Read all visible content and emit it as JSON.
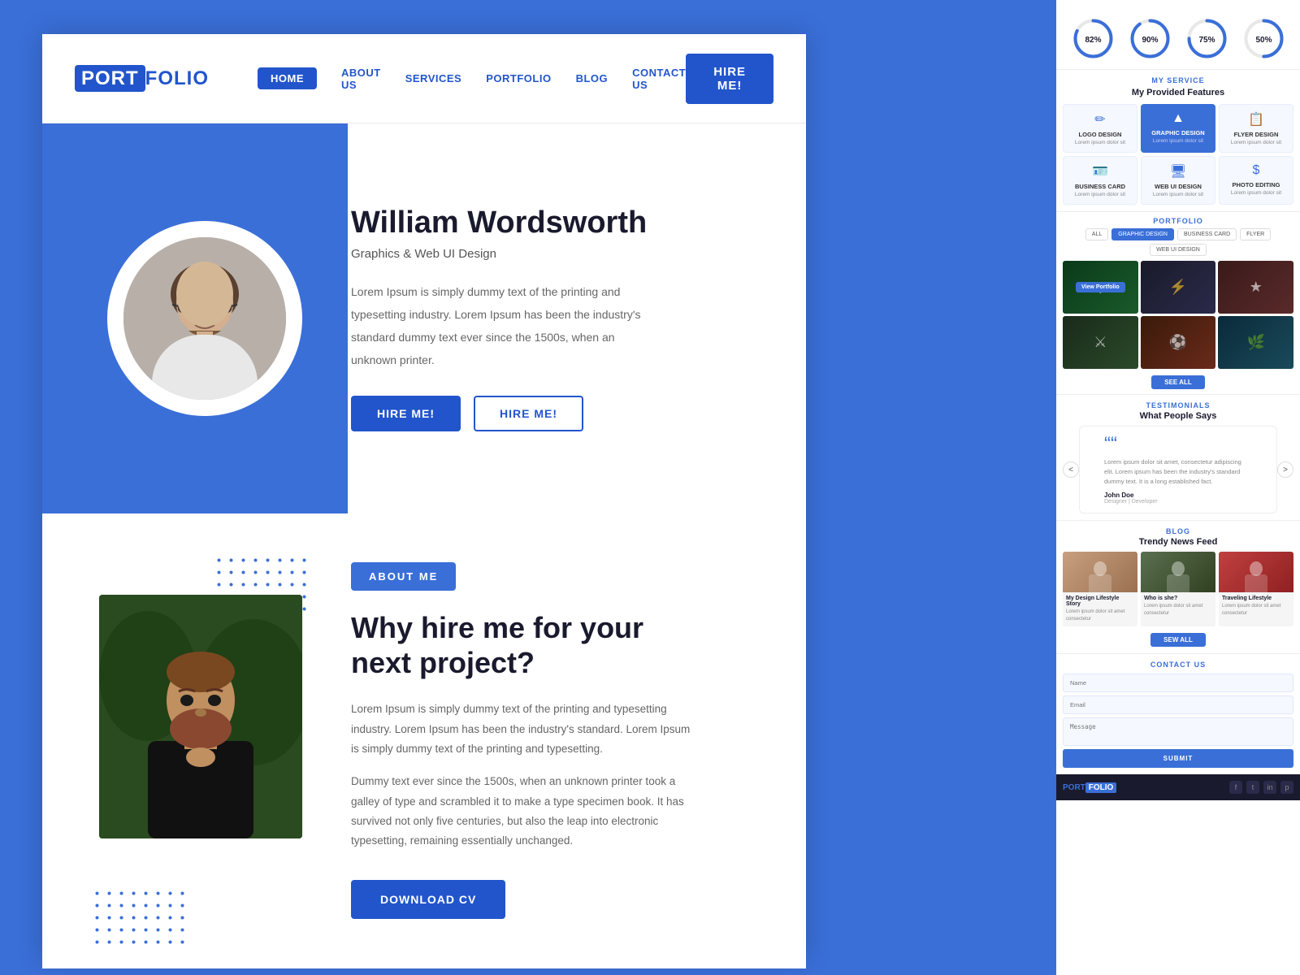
{
  "logo": {
    "port": "PORT",
    "folio": "FOLIO"
  },
  "nav": {
    "items": [
      {
        "label": "HOME",
        "active": true
      },
      {
        "label": "ABOUT US",
        "active": false
      },
      {
        "label": "SERVICES",
        "active": false
      },
      {
        "label": "PORTFOLIO",
        "active": false
      },
      {
        "label": "BLOG",
        "active": false
      },
      {
        "label": "CONTACT US",
        "active": false
      }
    ],
    "hire_button": "HIRE ME!"
  },
  "hero": {
    "name": "William Wordsworth",
    "subtitle": "Graphics & Web UI Design",
    "description": "Lorem Ipsum is simply dummy text of the printing and typesetting industry. Lorem Ipsum has been the industry's standard dummy text ever since the 1500s, when an unknown printer.",
    "button_primary": "HIRE ME!",
    "button_outline": "HIRE ME!"
  },
  "about": {
    "badge": "ABOUT ME",
    "heading_line1": "Why hire me for your",
    "heading_line2": "next project?",
    "text1": "Lorem Ipsum is simply dummy text of the printing and typesetting industry. Lorem Ipsum has been the industry's standard. Lorem Ipsum is simply dummy text of the printing and typesetting.",
    "text2": "Dummy text ever since the 1500s, when an unknown printer took a galley of type and scrambled it to make a type specimen book. It has survived not only five centuries, but also the leap into electronic typesetting, remaining essentially unchanged.",
    "download_btn": "DOWNLOAD CV"
  },
  "skills": [
    {
      "label": "82%",
      "pct": 82
    },
    {
      "label": "90%",
      "pct": 90
    },
    {
      "label": "75%",
      "pct": 75
    },
    {
      "label": "50%",
      "pct": 50
    }
  ],
  "services": {
    "label": "MY SERVICE",
    "title": "My Provided Features",
    "items": [
      {
        "icon": "✏",
        "name": "LOGO DESIGN",
        "highlight": false
      },
      {
        "icon": "▲",
        "name": "GRAPHIC DESIGN",
        "highlight": true
      },
      {
        "icon": "📄",
        "name": "FLYER DESIGN",
        "highlight": false
      },
      {
        "icon": "🪪",
        "name": "BUSINESS CARD",
        "highlight": false
      },
      {
        "icon": "🖥",
        "name": "WEB UI DESIGN",
        "highlight": false
      },
      {
        "icon": "$",
        "name": "PHOTO EDITING",
        "highlight": false
      }
    ]
  },
  "portfolio": {
    "label": "PORTFOLIO",
    "filter_tabs": [
      "ALL",
      "GRAPHIC DESIGN",
      "BUSINESS CARD",
      "FLYER",
      "WEB UI DESIGN"
    ],
    "active_tab": "GRAPHIC DESIGN",
    "view_label": "View Portfolio",
    "see_all": "SEE ALL"
  },
  "testimonials": {
    "label": "TESTIMONIALS",
    "title": "What People Says",
    "quote": "““",
    "text": "Lorem ipsum dolor sit amet, consectetur adipiscing elit. Lorem ipsum has been the industry's standard dummy text. It is a long established fact.",
    "author": "John Doe",
    "role": "Designer | Developer",
    "nav_left": "<",
    "nav_right": ">"
  },
  "blog": {
    "label": "BLOG",
    "title": "Trendy News Feed",
    "items": [
      {
        "title": "My Design Lifestyle Story",
        "text": "Lorem ipsum dolor sit amet consectetur"
      },
      {
        "title": "Who is she?",
        "text": "Lorem ipsum dolor sit amet consectetur"
      },
      {
        "title": "Traveling Lifestyle",
        "text": "Lorem ipsum dolor sit amet consectetur"
      }
    ],
    "see_all": "SEW ALL"
  },
  "contact": {
    "label": "CONTACT US",
    "placeholder_name": "Name",
    "placeholder_email": "Email",
    "placeholder_message": "Message",
    "submit": "SUBMIT"
  },
  "footer": {
    "logo_port": "PORT",
    "logo_folio": "FOLIO",
    "social_icons": [
      "f",
      "t",
      "in",
      "p"
    ]
  }
}
